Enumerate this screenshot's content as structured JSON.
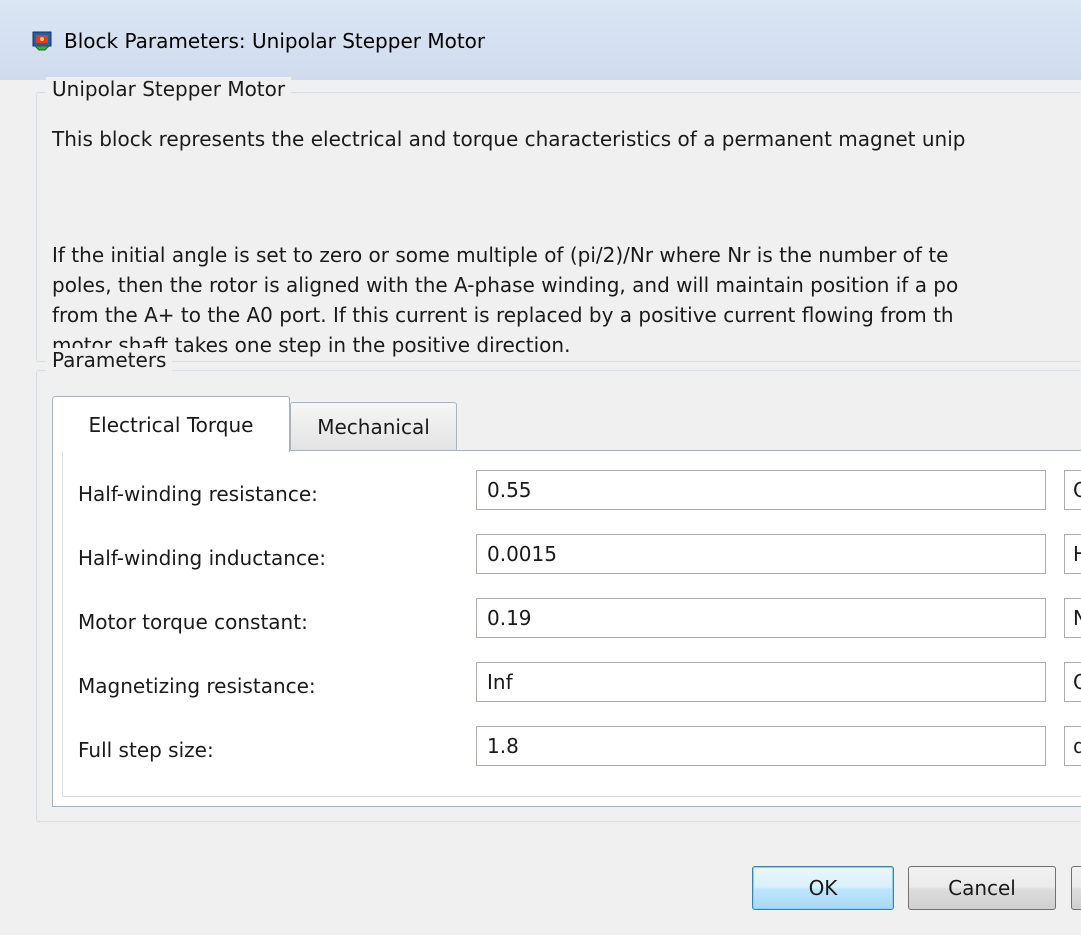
{
  "window": {
    "title": "Block Parameters: Unipolar Stepper Motor"
  },
  "description": {
    "group_title": "Unipolar Stepper Motor",
    "line1": "This block represents the electrical and torque characteristics of a permanent magnet unip",
    "para2": [
      "If the initial angle is set to zero or some multiple of (pi/2)/Nr where Nr is the number of te",
      "poles, then the rotor is aligned with the A-phase winding, and will maintain position if a po",
      "from the A+ to the A0 port. If this current is replaced by a positive current flowing from th",
      "motor shaft takes one step in the positive direction."
    ]
  },
  "parameters": {
    "group_title": "Parameters",
    "tabs": [
      {
        "label": "Electrical Torque",
        "active": true
      },
      {
        "label": "Mechanical",
        "active": false
      }
    ],
    "fields": [
      {
        "label": "Half-winding resistance:",
        "value": "0.55",
        "unit": "O"
      },
      {
        "label": "Half-winding inductance:",
        "value": "0.0015",
        "unit": "H"
      },
      {
        "label": "Motor torque constant:",
        "value": "0.19",
        "unit": "N"
      },
      {
        "label": "Magnetizing resistance:",
        "value": "Inf",
        "unit": "O"
      },
      {
        "label": "Full step size:",
        "value": "1.8",
        "unit": "d"
      }
    ]
  },
  "buttons": {
    "ok": "OK",
    "cancel": "Cancel",
    "help": ""
  },
  "colors": {
    "titlebar": "#dbe6f4",
    "dialog_bg": "#f0f0f0",
    "ok_accent": "#3c7fb1"
  },
  "icons": {
    "app": "simulink-block-icon"
  }
}
